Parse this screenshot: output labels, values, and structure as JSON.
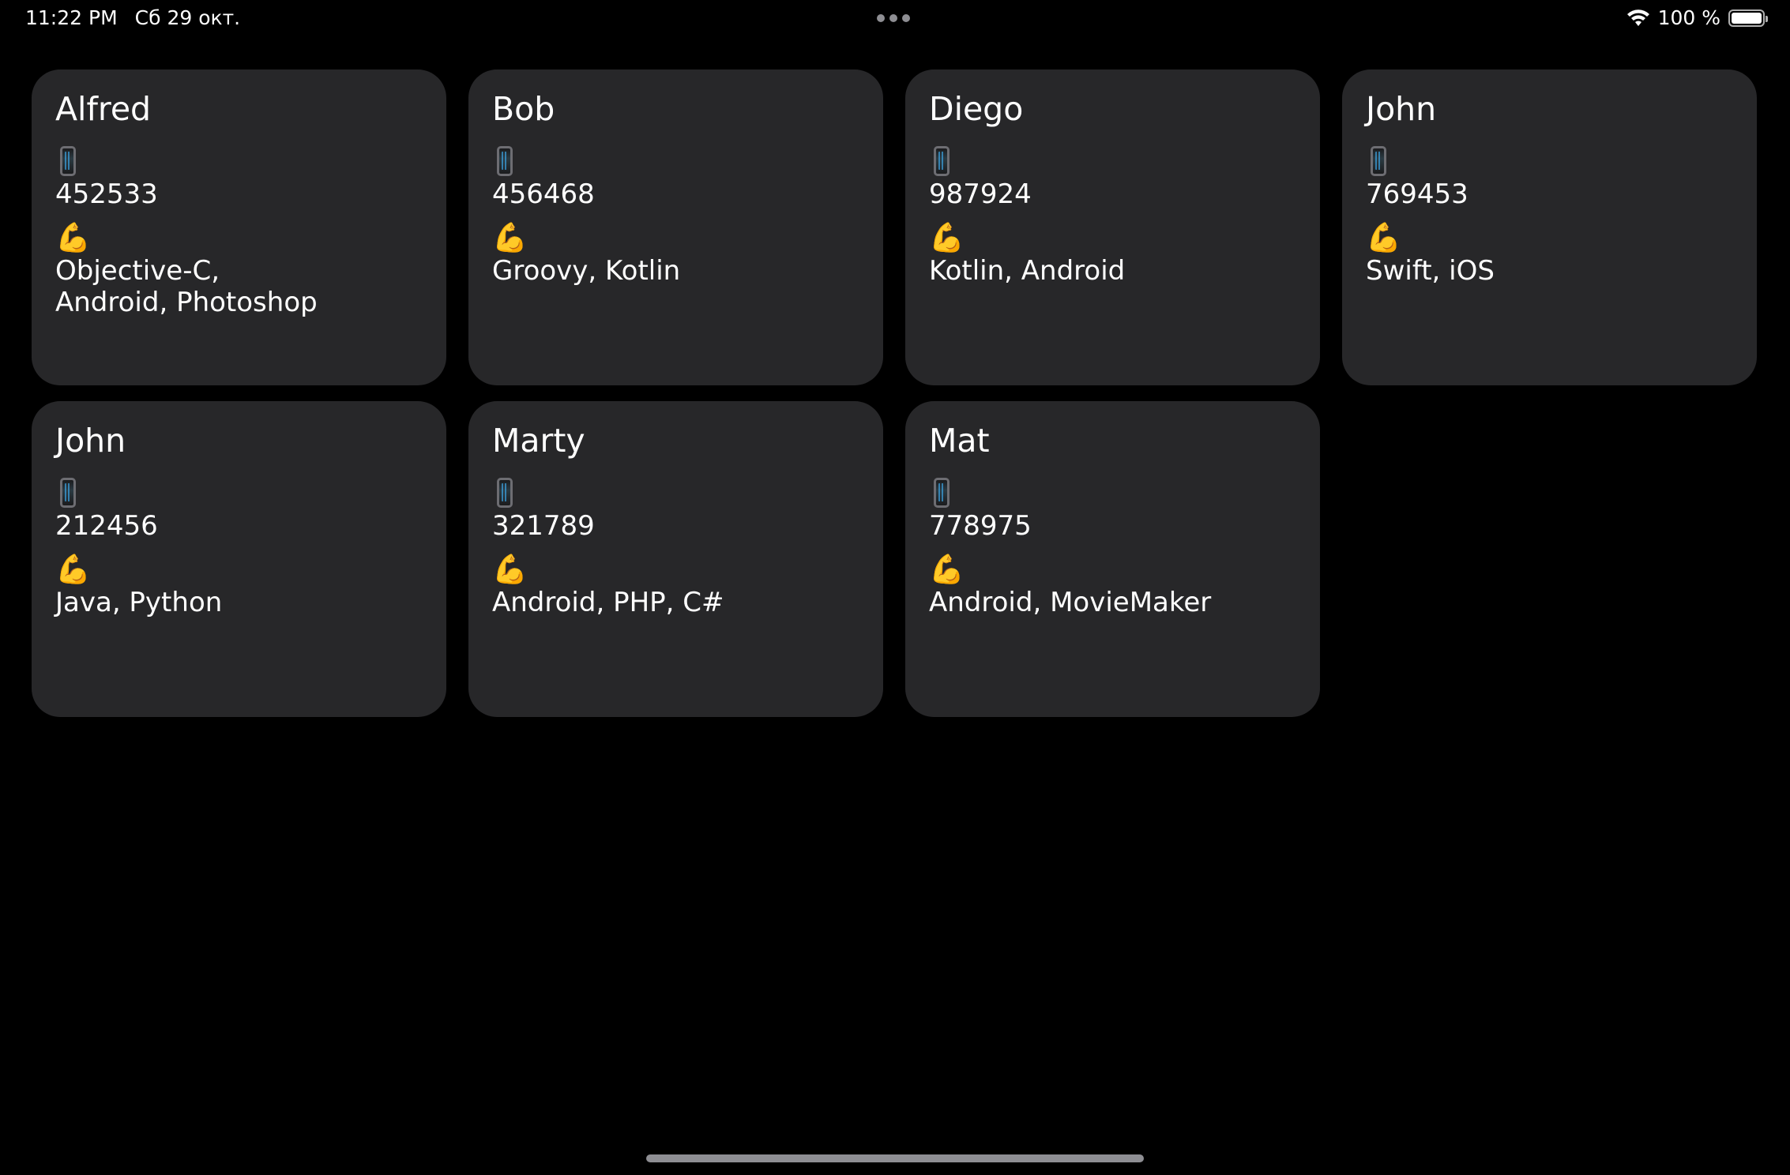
{
  "status_bar": {
    "time": "11:22 PM",
    "date": "Сб 29 окт.",
    "battery": "100 %"
  },
  "icons": {
    "phone": "mobile-phone-icon",
    "skills": "flexed-biceps-icon"
  },
  "cards": [
    {
      "name": "Alfred",
      "phone": "452533",
      "skills": "Objective-C,\nAndroid, Photoshop"
    },
    {
      "name": "Bob",
      "phone": "456468",
      "skills": "Groovy, Kotlin"
    },
    {
      "name": "Diego",
      "phone": "987924",
      "skills": "Kotlin, Android"
    },
    {
      "name": "John",
      "phone": "769453",
      "skills": "Swift, iOS"
    },
    {
      "name": "John",
      "phone": "212456",
      "skills": "Java, Python"
    },
    {
      "name": "Marty",
      "phone": "321789",
      "skills": "Android, PHP, C#"
    },
    {
      "name": "Mat",
      "phone": "778975",
      "skills": "Android, MovieMaker"
    }
  ]
}
